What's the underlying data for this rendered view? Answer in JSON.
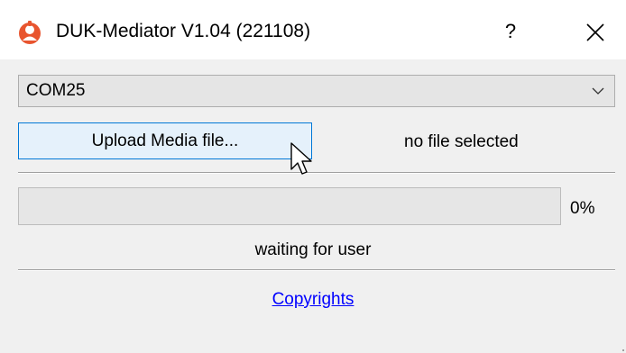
{
  "window": {
    "title": "DUK-Mediator V1.04 (221108)",
    "help_label": "?",
    "app_icon": "duk-mediator-logo-icon",
    "close_icon": "close-icon",
    "background": "#f0f0f0"
  },
  "port": {
    "selected": "COM25",
    "icon": "chevron-down-icon"
  },
  "upload": {
    "button_label": "Upload Media file...",
    "file_status": "no file selected",
    "accent": "#0078d7"
  },
  "progress": {
    "value": 0,
    "percent_label": "0%",
    "status": "waiting for user"
  },
  "footer": {
    "link_label": "Copyrights",
    "link_color": "#0000ff"
  }
}
